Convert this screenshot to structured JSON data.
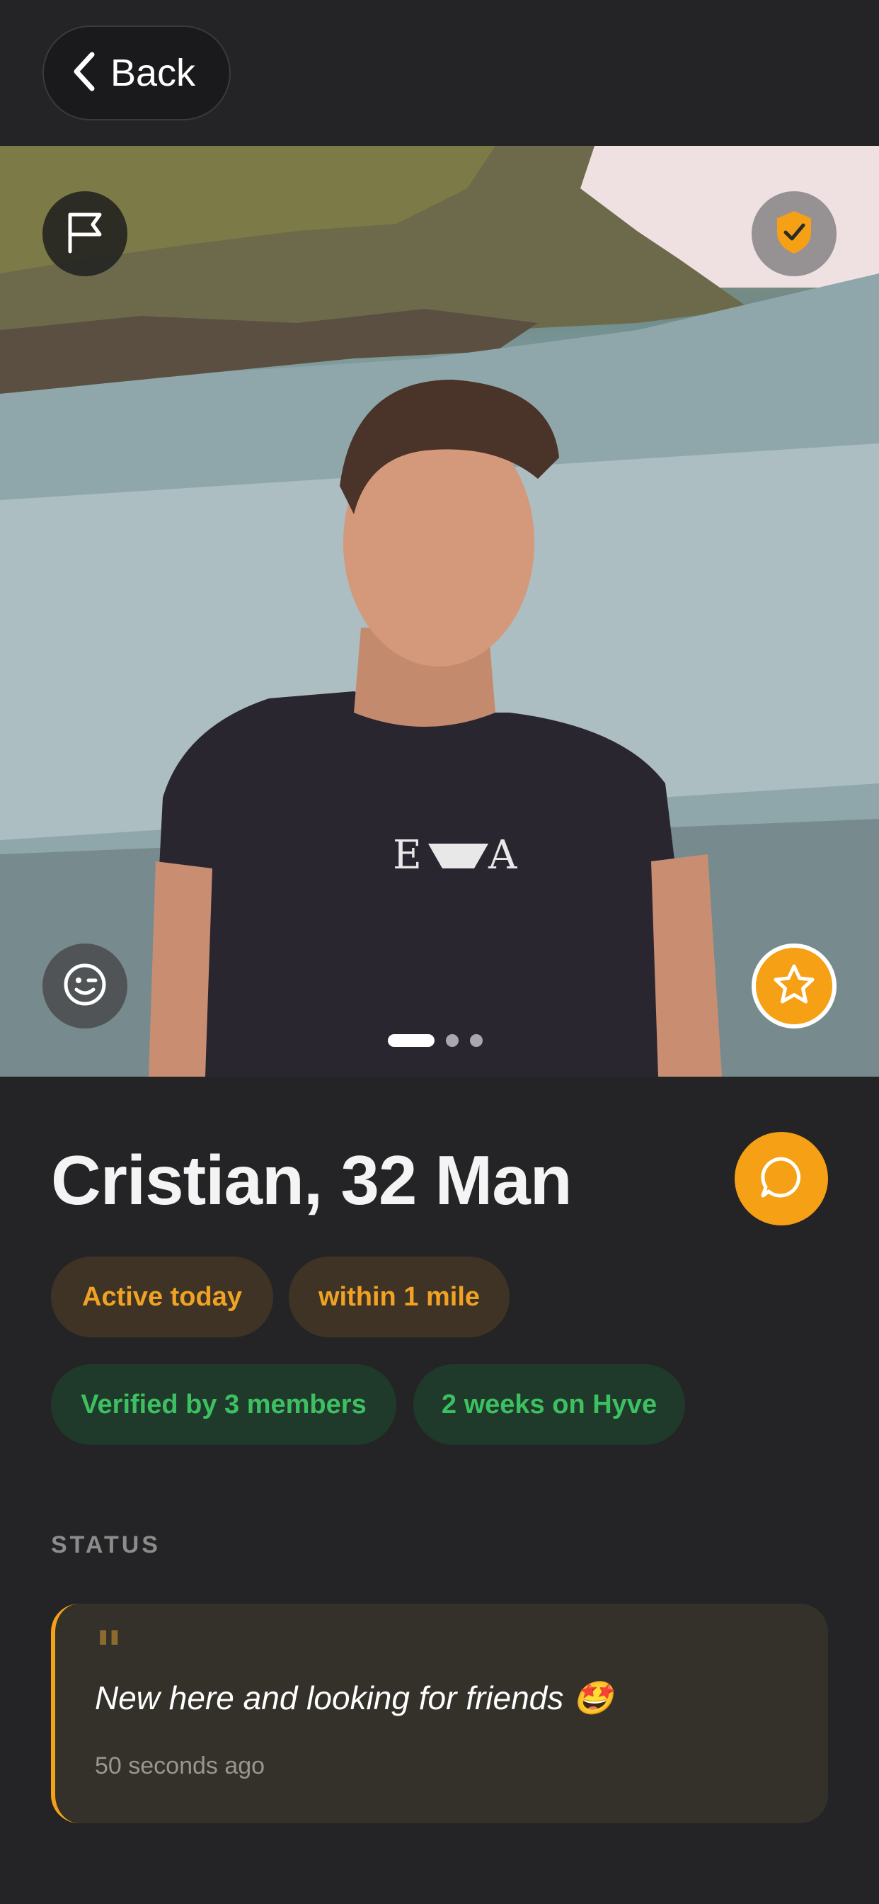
{
  "header": {
    "back_label": "Back"
  },
  "profile": {
    "name_line": "Cristian, 32 Man",
    "photo_count": 3,
    "active_photo": 1,
    "chips_row1": [
      "Active today",
      "within 1 mile"
    ],
    "chips_row2": [
      "Verified by 3 members",
      "2 weeks on Hyve"
    ]
  },
  "status": {
    "heading": "STATUS",
    "quote_mark": "\"",
    "text": "New here and looking for friends 🤩",
    "time": "50 seconds ago"
  },
  "icons": {
    "back": "chevron-left-icon",
    "flag": "flag-icon",
    "shield": "shield-check-icon",
    "wink": "wink-face-icon",
    "star": "star-icon",
    "chat": "chat-bubble-icon"
  },
  "colors": {
    "accent": "#f5a015",
    "background": "#242426",
    "green": "#3cc061"
  }
}
